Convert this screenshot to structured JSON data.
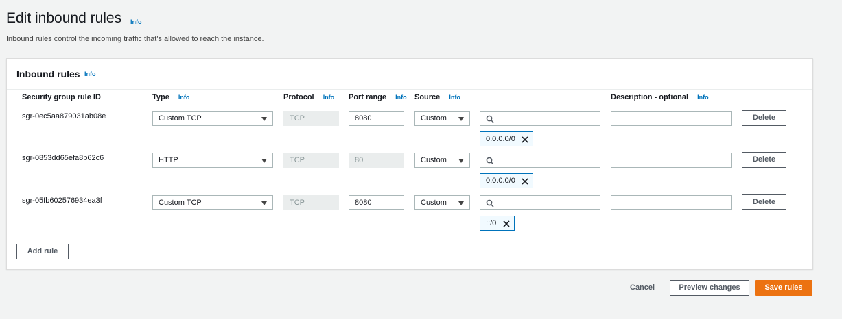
{
  "page": {
    "title": "Edit inbound rules",
    "info": "Info",
    "description": "Inbound rules control the incoming traffic that's allowed to reach the instance."
  },
  "panel": {
    "title": "Inbound rules",
    "info": "Info",
    "columns": {
      "rule_id": "Security group rule ID",
      "type": "Type",
      "protocol": "Protocol",
      "port_range": "Port range",
      "source": "Source",
      "description": "Description - optional",
      "info": "Info"
    },
    "rules": [
      {
        "id": "sgr-0ec5aa879031ab08e",
        "type": "Custom TCP",
        "protocol": "TCP",
        "port": "8080",
        "port_editable": true,
        "source": "Custom",
        "token": "0.0.0.0/0",
        "description": "",
        "delete_label": "Delete"
      },
      {
        "id": "sgr-0853dd65efa8b62c6",
        "type": "HTTP",
        "protocol": "TCP",
        "port": "80",
        "port_editable": false,
        "source": "Custom",
        "token": "0.0.0.0/0",
        "description": "",
        "delete_label": "Delete"
      },
      {
        "id": "sgr-05fb602576934ea3f",
        "type": "Custom TCP",
        "protocol": "TCP",
        "port": "8080",
        "port_editable": true,
        "source": "Custom",
        "token": "::/0",
        "description": "",
        "delete_label": "Delete"
      }
    ],
    "add_rule_label": "Add rule"
  },
  "footer": {
    "cancel_label": "Cancel",
    "preview_label": "Preview changes",
    "save_label": "Save rules"
  },
  "colors": {
    "background": "#f2f3f3",
    "link": "#0073bb",
    "primary": "#ec7211",
    "token_border": "#0073bb"
  },
  "icons": {
    "search": "search-icon",
    "dropdown": "caret-down-icon",
    "remove_token": "close-icon"
  }
}
